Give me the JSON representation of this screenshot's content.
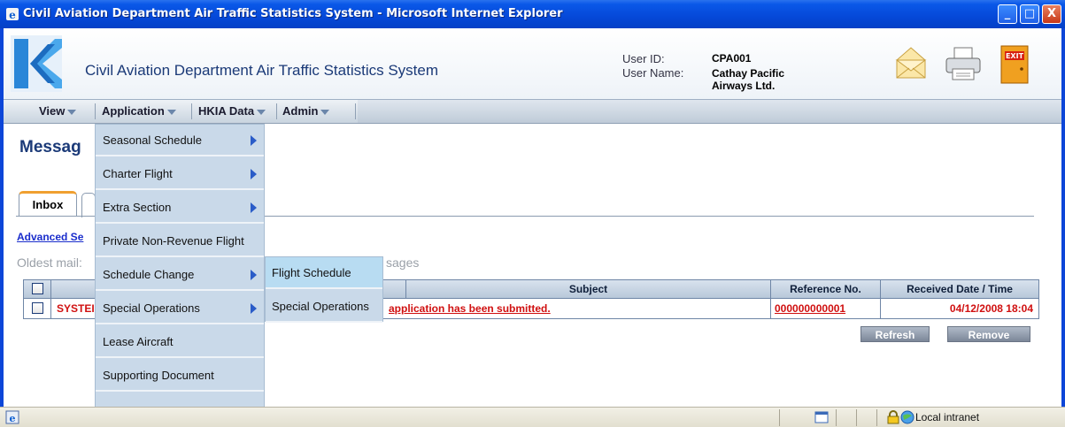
{
  "window": {
    "title": "Civil Aviation Department Air Traffic Statistics System - Microsoft Internet Explorer",
    "minimize": "_",
    "maximize": "□",
    "close": "X"
  },
  "header": {
    "app_title": "Civil Aviation Department Air Traffic Statistics System",
    "user_id_label": "User ID:",
    "user_id": "CPA001",
    "user_name_label": "User Name:",
    "user_name_line1": "Cathay Pacific",
    "user_name_line2": "Airways Ltd.",
    "icons": [
      "mail-icon",
      "printer-icon",
      "exit-icon"
    ],
    "exit_label": "EXIT"
  },
  "menubar": {
    "items": [
      {
        "label": "View"
      },
      {
        "label": "Application"
      },
      {
        "label": "HKIA Data"
      },
      {
        "label": "Admin"
      }
    ]
  },
  "page": {
    "heading": "Messag",
    "tabs": [
      {
        "label": "Inbox"
      }
    ],
    "advanced_search": "Advanced Se",
    "oldest_prefix": "Oldest mail:",
    "oldest_suffix": "sages"
  },
  "table": {
    "columns": [
      "",
      "",
      "Subject",
      "Reference No.",
      "Received Date / Time"
    ],
    "rows": [
      {
        "sender": "SYSTEI",
        "subject": "application has been submitted.",
        "reference": "000000000001",
        "received": "04/12/2008 18:04"
      }
    ]
  },
  "buttons": {
    "refresh": "Refresh",
    "remove": "Remove"
  },
  "dropdown": {
    "items": [
      {
        "label": "Seasonal Schedule",
        "has_submenu": true
      },
      {
        "label": "Charter Flight",
        "has_submenu": true
      },
      {
        "label": "Extra Section",
        "has_submenu": true
      },
      {
        "label": "Private Non-Revenue Flight",
        "has_submenu": false
      },
      {
        "label": "Schedule Change",
        "has_submenu": true
      },
      {
        "label": "Special Operations",
        "has_submenu": true
      },
      {
        "label": "Lease Aircraft",
        "has_submenu": false
      },
      {
        "label": "Supporting Document",
        "has_submenu": false
      }
    ]
  },
  "submenu": {
    "items": [
      {
        "label": "Flight Schedule"
      },
      {
        "label": "Special Operations"
      }
    ]
  },
  "statusbar": {
    "zone": "Local intranet"
  },
  "colors": {
    "titlebar": "#0548d8",
    "menu_bg": "#c9d9e9",
    "highlight": "#b8dcf2",
    "link_red": "#d01010",
    "heading_blue": "#1b3a78"
  }
}
